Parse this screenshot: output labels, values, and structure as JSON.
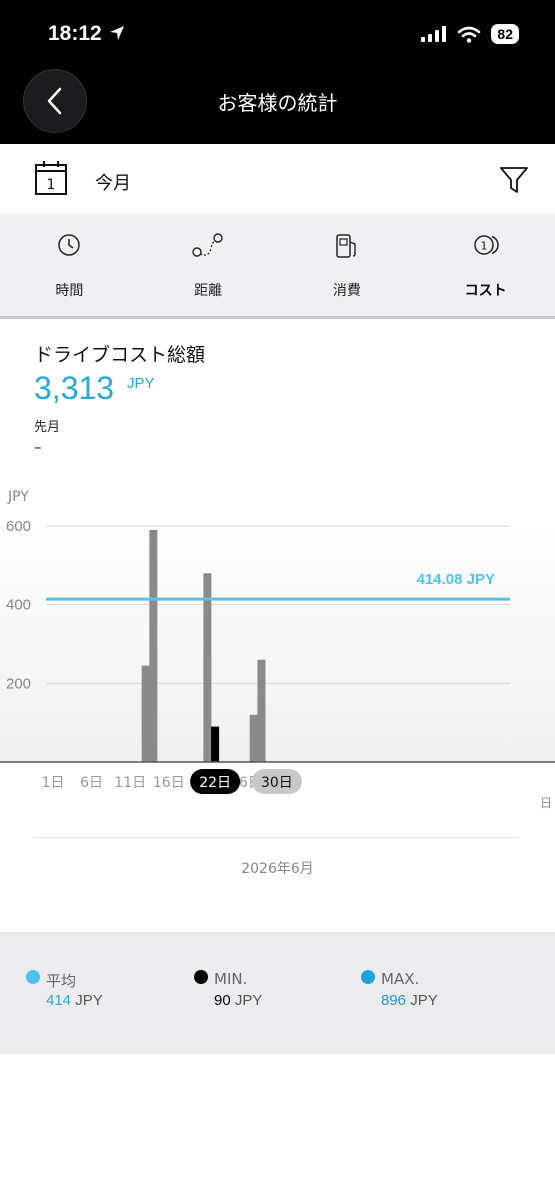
{
  "status_bar": {
    "time": "18:12",
    "battery": "82"
  },
  "header": {
    "title": "お客様の統計"
  },
  "period": {
    "label": "今月",
    "calendar_day": "1"
  },
  "tabs": [
    {
      "label": "時間",
      "icon": "clock-icon",
      "active": false
    },
    {
      "label": "距離",
      "icon": "route-icon",
      "active": false
    },
    {
      "label": "消費",
      "icon": "fuel-icon",
      "active": false
    },
    {
      "label": "コスト",
      "icon": "coin-icon",
      "active": true
    }
  ],
  "summary": {
    "title": "ドライブコスト総額",
    "value": "3,313",
    "unit": "JPY",
    "previous_label": "先月",
    "previous_value": "–"
  },
  "chart_data": {
    "type": "bar",
    "ylabel": "JPY",
    "xlabel_unit": "日",
    "ylim": [
      0,
      600
    ],
    "yticks": [
      "200",
      "400",
      "600"
    ],
    "y_tick_values": [
      200,
      400,
      600
    ],
    "x_tick_labels": [
      "1日",
      "6日",
      "11日",
      "16日",
      "2",
      "26日"
    ],
    "x_tick_days": [
      1,
      6,
      11,
      16,
      21,
      26
    ],
    "highlight_labels": [
      {
        "label": "22日",
        "day": 22,
        "style": "selected"
      },
      {
        "label": "30日",
        "day": 30,
        "style": "today"
      }
    ],
    "average_line": {
      "value": 414.08,
      "label": "414.08 JPY"
    },
    "bars": [
      {
        "day": 13,
        "value": 245,
        "selected": false
      },
      {
        "day": 14,
        "value": 590,
        "selected": false
      },
      {
        "day": 21,
        "value": 480,
        "selected": false
      },
      {
        "day": 22,
        "value": 90,
        "selected": true
      },
      {
        "day": 27,
        "value": 120,
        "selected": false
      },
      {
        "day": 28,
        "value": 260,
        "selected": false
      }
    ],
    "month": "2026年6月"
  },
  "legend": [
    {
      "label": "平均",
      "value": "414",
      "unit": "JPY",
      "dot_color": "#4fc3ef",
      "value_color": "#2aa8d8"
    },
    {
      "label": "MIN.",
      "value": "90",
      "unit": "JPY",
      "dot_color": "#000000",
      "value_color": "#000000"
    },
    {
      "label": "MAX.",
      "value": "896",
      "unit": "JPY",
      "dot_color": "#1ea2e0",
      "value_color": "#1e96d6"
    }
  ]
}
